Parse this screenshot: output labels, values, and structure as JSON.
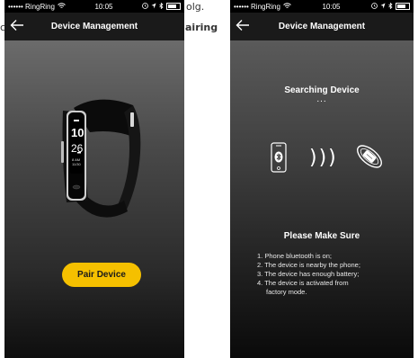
{
  "background": {
    "snippet_top": "olg.",
    "snippet_left": "c",
    "snippet_mid": "airing"
  },
  "left_screen": {
    "status": {
      "carrier": "•••••• RingRing",
      "time": "10:05"
    },
    "nav": {
      "title": "Device Management"
    },
    "band_display": {
      "top": "10",
      "middle": "26",
      "small_top": "8 AM",
      "small_bottom": "11/30"
    },
    "pair_button": "Pair Device"
  },
  "right_screen": {
    "status": {
      "carrier": "•••••• RingRing",
      "time": "10:05"
    },
    "nav": {
      "title": "Device Management"
    },
    "searching_title": "Searching Device",
    "searching_dots": "...",
    "waves": ")))",
    "make_sure_title": "Please Make Sure",
    "checklist": [
      "1. Phone bluetooth is on;",
      "2. The device  is nearby the phone;",
      "3. The device has enough battery;",
      "4. The device is activated from",
      "factory mode."
    ]
  },
  "colors": {
    "accent": "#f5c000",
    "navbar": "#1a1a1a"
  }
}
